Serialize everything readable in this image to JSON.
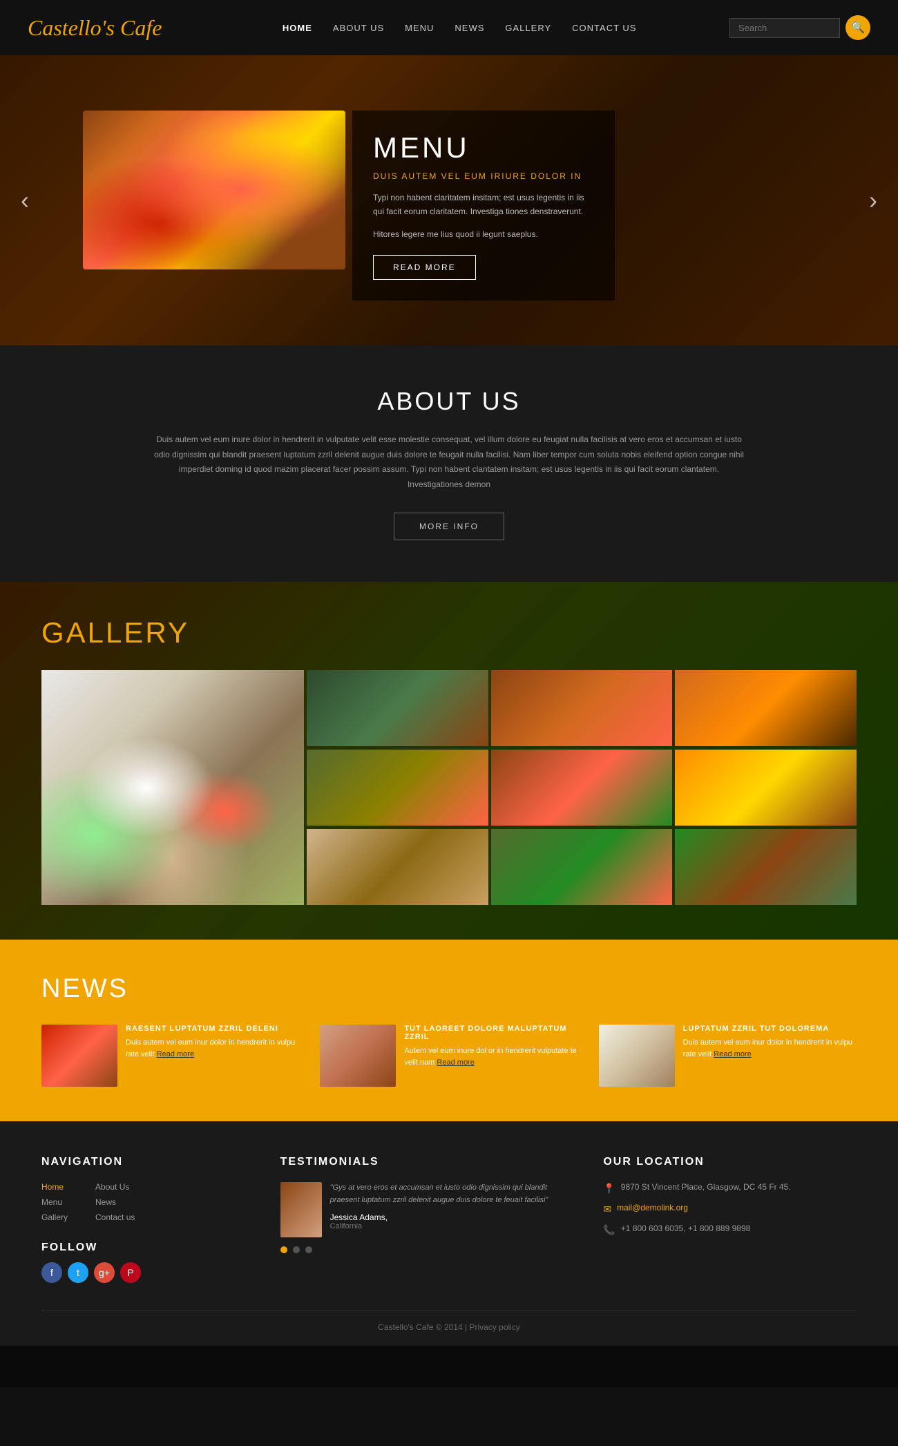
{
  "header": {
    "logo": "Castello's Cafe",
    "nav": [
      {
        "label": "HOME",
        "active": true
      },
      {
        "label": "ABOUT US",
        "active": false
      },
      {
        "label": "MENU",
        "active": false
      },
      {
        "label": "NEWS",
        "active": false
      },
      {
        "label": "GALLERY",
        "active": false
      },
      {
        "label": "CONTACT US",
        "active": false
      }
    ],
    "search_placeholder": "Search",
    "search_icon": "🔍"
  },
  "hero": {
    "title": "MENU",
    "subtitle": "DUIS AUTEM VEL EUM IRIURE DOLOR IN",
    "text1": "Typi non habent claritatem insitam; est usus legentis in iis qui facit eorum claritatem. Investiga tiones denstraverunt.",
    "text2": "Hitores legere me lius quod ii legunt saeplus.",
    "btn_label": "READ MORE",
    "arrow_left": "‹",
    "arrow_right": "›"
  },
  "about": {
    "title": "ABOUT US",
    "text": "Duis autem vel eum inure dolor in hendrerit in vulputate velit esse molestie consequat, vel illum dolore eu feugiat nulla facilisis at vero eros et accumsan et iusto odio dignissim qui blandit praesent luptatum zzril delenit augue duis dolore te feugait nulla facilisi. Nam liber tempor cum soluta nobis eleifend option congue nihil imperdiet doming id quod mazim placerat facer possim assum. Typi non habent clantatem insitam; est usus legentis in iis qui facit eorum clantatem. Investigationes demon",
    "btn_label": "MORE INFO"
  },
  "gallery": {
    "title_white": "GALL",
    "title_yellow": "E",
    "title_rest": "RY"
  },
  "news": {
    "title": "NEWS",
    "items": [
      {
        "title": "RAESENT LUPTATUM ZZRIL DELENI",
        "text": "Duis autem vel eum inur dolor in hendrerit in vulpu rate velit",
        "read_more": "Read more"
      },
      {
        "title": "TUT LAOREET DOLORE MALUPTATUM ZZRIL",
        "text": "Autem vel eum inure dol or in hendrerit vulputate te velit nam",
        "read_more": "Read more"
      },
      {
        "title": "LUPTATUM ZZRIL TUT DOLOREMA",
        "text": "Duis autem vel eum inur dolor in hendrerit in vulpu rate velit",
        "read_more": "Read more"
      }
    ]
  },
  "footer": {
    "navigation": {
      "title": "NAVIGATION",
      "col1": [
        "Home",
        "Menu",
        "Gallery"
      ],
      "col2": [
        "About Us",
        "News",
        "Contact us"
      ]
    },
    "testimonials": {
      "title": "TESTIMONIALS",
      "text": "\"Gys at vero eros et accumsan et iusto odio dignissim qui blandit praesent luptatum zzril delenit augue duis dolore te feuait facilisi\"",
      "name": "Jessica Adams,",
      "location": "California"
    },
    "location": {
      "title": "OUR LOCATION",
      "address": "9870 St Vincent Place, Glasgow, DC 45 Fr 45.",
      "email": "mail@demolink.org",
      "phone": "+1 800 603 6035, +1 800 889 9898"
    },
    "follow": {
      "title": "FOLLOW"
    },
    "copyright": "Castello's Cafe © 2014 | Privacy policy"
  }
}
